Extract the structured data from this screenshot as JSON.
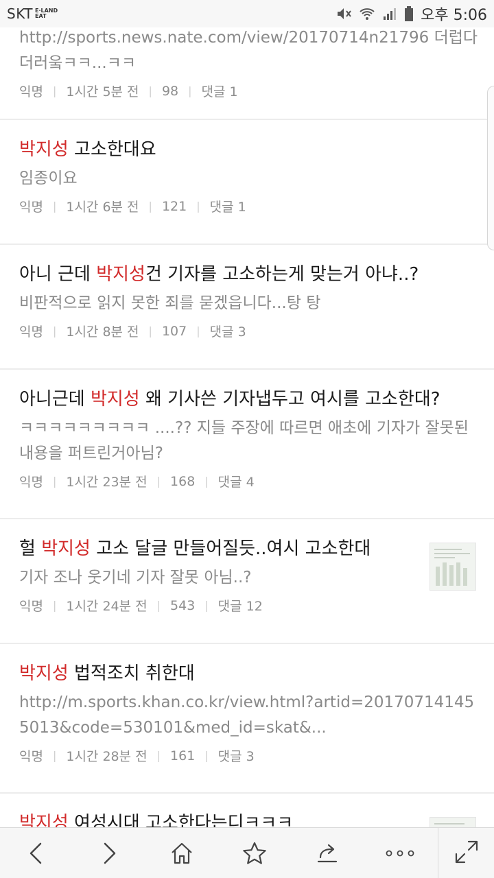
{
  "status_bar": {
    "carrier": "SKT",
    "carrier_logo_top": "E·LAND",
    "carrier_logo_bottom": "EAT",
    "ampm": "오후",
    "time": "5:06"
  },
  "posts": [
    {
      "title_pre": "",
      "title_hl": "",
      "title_post": "",
      "body": "http://sports.news.nate.com/view/20170714n21796 더럽다 더러웈ㅋㅋ...ㅋㅋ",
      "author": "익명",
      "time": "1시간 5분 전",
      "views": "98",
      "comments": "댓글 1"
    },
    {
      "title_pre": "",
      "title_hl": "박지성",
      "title_post": " 고소한대요",
      "body": "임종이요",
      "author": "익명",
      "time": "1시간 6분 전",
      "views": "121",
      "comments": "댓글 1"
    },
    {
      "title_pre": "아니 근데 ",
      "title_hl": "박지성",
      "title_post": "건 기자를 고소하는게 맞는거 아냐..?",
      "body": "비판적으로 읽지 못한 죄를 묻겠읍니다...탕 탕",
      "author": "익명",
      "time": "1시간 8분 전",
      "views": "107",
      "comments": "댓글 3"
    },
    {
      "title_pre": "아니근데 ",
      "title_hl": "박지성",
      "title_post": " 왜 기사쓴 기자냅두고 여시를 고소한대?",
      "body": "ㅋㅋㅋㅋㅋㅋㅋㅋㅋ ....?? 지들 주장에 따르면 애초에 기자가 잘못된 내용을 퍼트린거아님?",
      "author": "익명",
      "time": "1시간 23분 전",
      "views": "168",
      "comments": "댓글 4"
    },
    {
      "title_pre": "헐 ",
      "title_hl": "박지성",
      "title_post": " 고소 달글 만들어질듯..여시 고소한대",
      "body": "기자 조나 웃기네 기자 잘못 아님..?",
      "author": "익명",
      "time": "1시간 24분 전",
      "views": "543",
      "comments": "댓글 12"
    },
    {
      "title_pre": "",
      "title_hl": "박지성",
      "title_post": " 법적조치 취한대",
      "body": "http://m.sports.khan.co.kr/view.html?artid=201707141455013&code=530101&med_id=skat&...",
      "author": "익명",
      "time": "1시간 28분 전",
      "views": "161",
      "comments": "댓글 3"
    },
    {
      "title_pre": "",
      "title_hl": "박지성",
      "title_post": " 여성시대 고소한다는디ㅋㅋㅋ",
      "body": "",
      "author": "",
      "time": "",
      "views": "",
      "comments": ""
    }
  ],
  "bottom_nav": {
    "icons": [
      "back-icon",
      "forward-icon",
      "home-icon",
      "bookmark-star-icon",
      "share-icon",
      "more-icon",
      "fullscreen-icon"
    ]
  }
}
